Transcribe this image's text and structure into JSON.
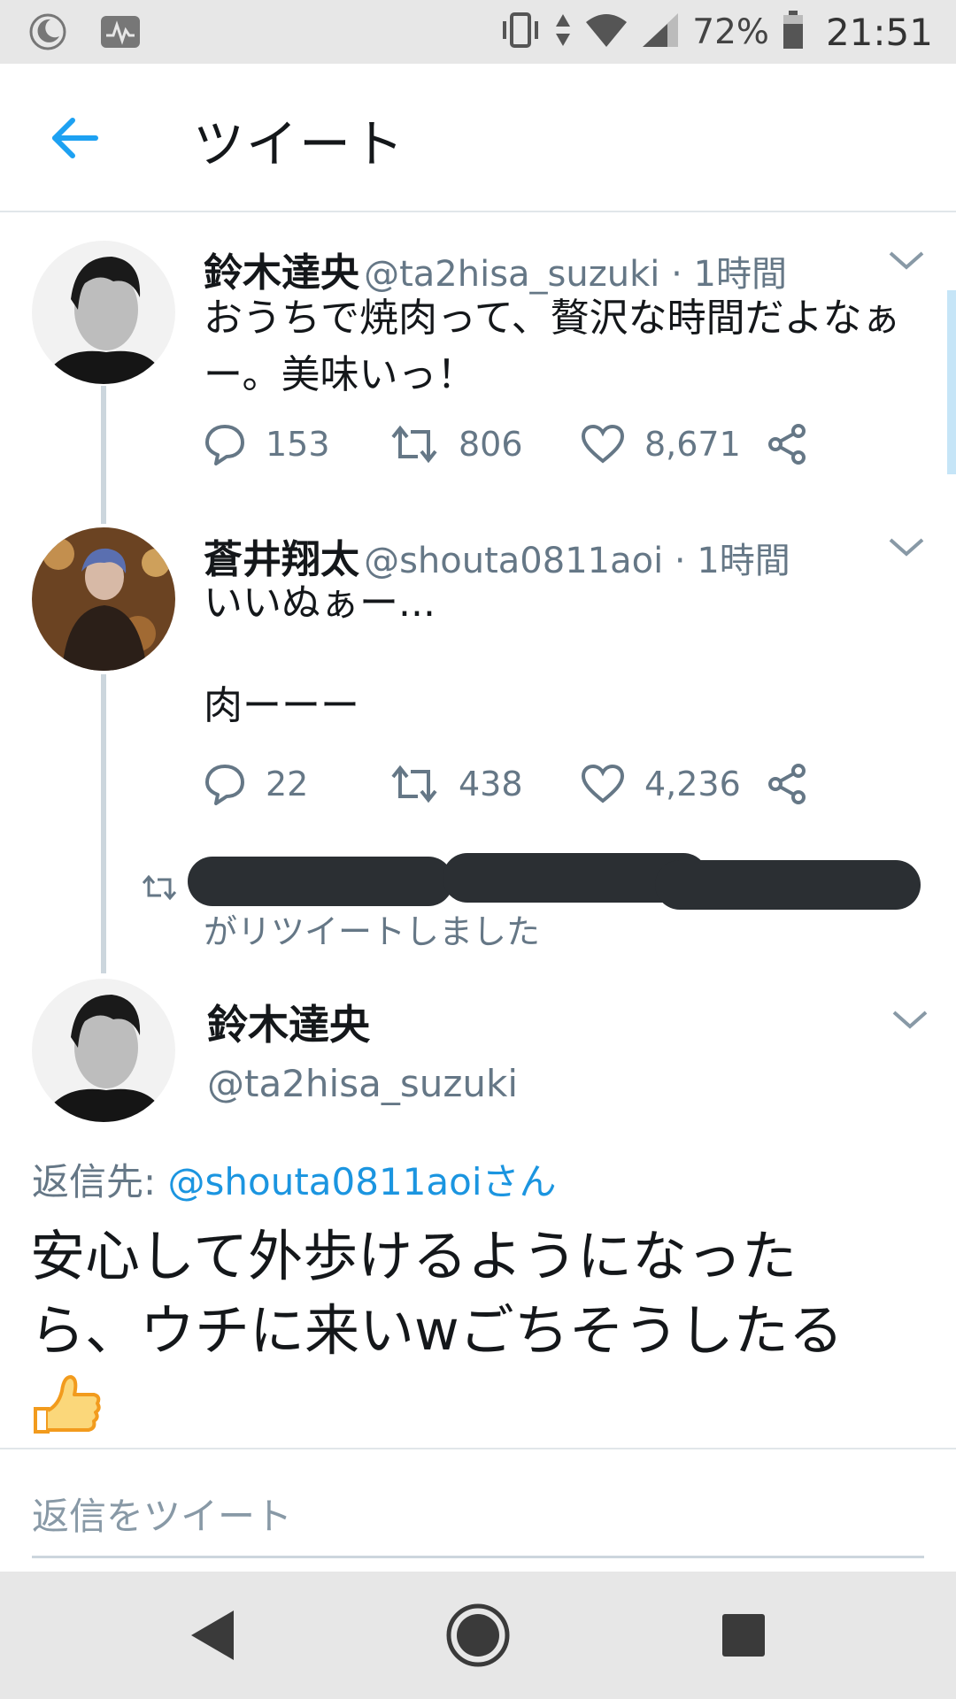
{
  "status_bar": {
    "battery_percent": "72%",
    "time": "21:51",
    "left_icons": [
      "moon-icon",
      "activity-icon"
    ],
    "right_icons": [
      "vibrate-icon",
      "data-arrows-icon",
      "wifi-icon",
      "signal-icon",
      "battery-icon"
    ]
  },
  "header": {
    "title": "ツイート",
    "back_icon": "back-arrow-icon"
  },
  "tweets": [
    {
      "name": "鈴木達央",
      "handle": "@ta2hisa_suzuki · 1時間",
      "text_lines": [
        "おうちで焼肉って、贅沢な時間だよなぁ",
        "ー。美味いっ！"
      ],
      "replies": "153",
      "retweets": "806",
      "likes": "8,671"
    },
    {
      "name": "蒼井翔太",
      "handle": "@shouta0811aoi · 1時間",
      "text_lines": [
        "いいぬぁー...",
        "",
        "肉ーーー"
      ],
      "replies": "22",
      "retweets": "438",
      "likes": "4,236"
    }
  ],
  "retweet_notice": {
    "label": "がリツイートしました"
  },
  "main_tweet": {
    "name": "鈴木達央",
    "handle": "@ta2hisa_suzuki",
    "reply_prefix": "返信先: ",
    "reply_mention": "@shouta0811aoiさん",
    "text_lines": [
      "安心して外歩けるようになった",
      "ら、ウチに来いwごちそうしたる"
    ],
    "emoji": "thumbs-up"
  },
  "reply_box": {
    "placeholder": "返信をツイート"
  },
  "colors": {
    "accent": "#1da1f2",
    "mention": "#1b95e0",
    "secondary_text": "#657786",
    "primary_text": "#14171a",
    "system_bar": "#e7e7e7"
  }
}
